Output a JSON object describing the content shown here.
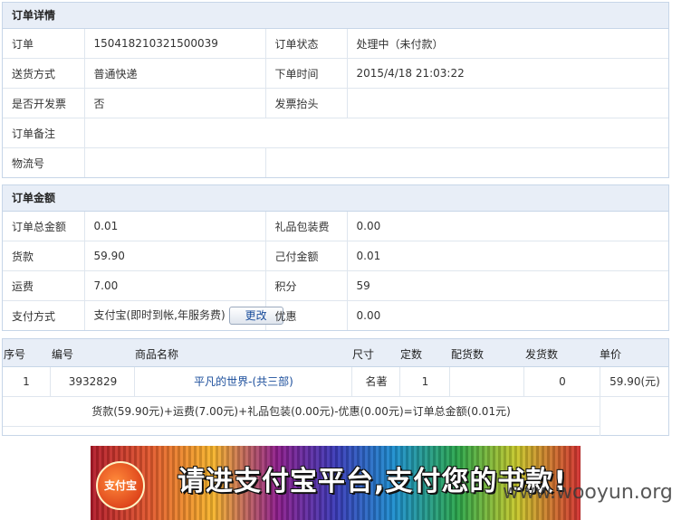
{
  "order_details": {
    "title": "订单详情",
    "rows": [
      {
        "l1": "订单",
        "v1": "150418210321500039",
        "l2": "订单状态",
        "v2": "处理中（未付款）"
      },
      {
        "l1": "送货方式",
        "v1": "普通快递",
        "l2": "下单时间",
        "v2": "2015/4/18 21:03:22"
      },
      {
        "l1": "是否开发票",
        "v1": "否",
        "l2": "发票抬头",
        "v2": ""
      },
      {
        "l1": "订单备注",
        "v1": ""
      },
      {
        "l1": "物流号",
        "v1": "",
        "l2": "",
        "v2": ""
      }
    ]
  },
  "order_amount": {
    "title": "订单金额",
    "rows": [
      {
        "l1": "订单总金额",
        "v1": "0.01",
        "l2": "礼品包装费",
        "v2": "0.00"
      },
      {
        "l1": "货款",
        "v1": "59.90",
        "l2": "己付金额",
        "v2": "0.01"
      },
      {
        "l1": "运费",
        "v1": "7.00",
        "l2": "积分",
        "v2": "59"
      },
      {
        "l1": "支付方式",
        "v1": "支付宝(即时到帐,年服务费)",
        "l2": "优惠",
        "v2": "0.00"
      }
    ],
    "change_button": "更改"
  },
  "goods": {
    "headers": [
      "序号",
      "编号",
      "商品名称",
      "尺寸",
      "定数",
      "配货数",
      "发货数",
      "单价"
    ],
    "rows": [
      {
        "index": "1",
        "code": "3932829",
        "name": "平凡的世界-(共三部)",
        "size": "名著",
        "qty": "1",
        "allocated": "",
        "shipped": "0",
        "price": "59.90(元)"
      }
    ],
    "summary": "货款(59.90元)+运费(7.00元)+礼品包装(0.00元)-优惠(0.00元)=订单总金额(0.01元)"
  },
  "banner": {
    "logo_text": "支付宝",
    "text": "请进支付宝平台,支付您的书款!"
  },
  "watermark": "www.wooyun.org"
}
